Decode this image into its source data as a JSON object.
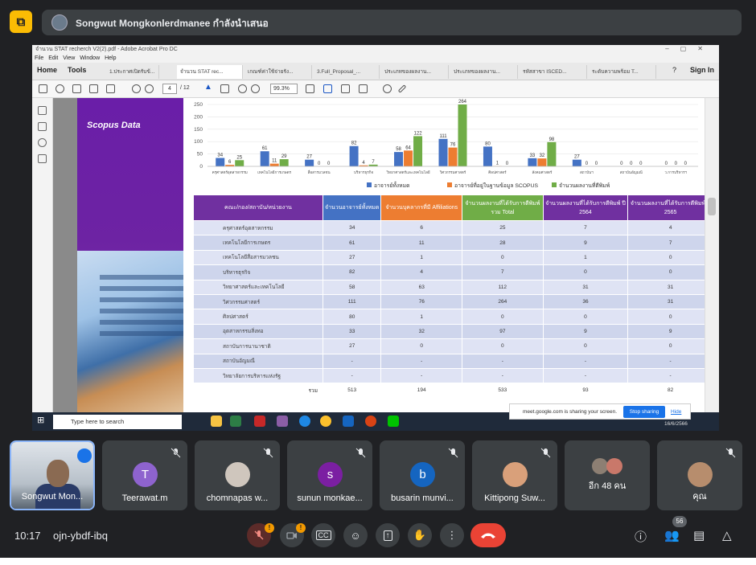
{
  "presenter": {
    "text": "Songwut Mongkonlerdmanee กำลังนำเสนอ"
  },
  "acrobat": {
    "window_title": "จำนวน STAT recherch V2(2).pdf - Adobe Acrobat Pro DC",
    "menu": "File Edit View Window Help",
    "home": "Home",
    "tools": "Tools",
    "sign_in": "Sign In",
    "tabs": [
      "1.ประกาศเปิดรับข้...",
      "จำนวน STAT rec...",
      "เกณฑ์ค่าใช้จ่ายรัง...",
      "3.Full_Proposal_...",
      "ประเภทของผลงาน...",
      "ประเภทของผลงาน...",
      "รหัสสาขา ISCED...",
      "ระดับความพร้อม T..."
    ],
    "page_current": "4",
    "page_total": "/ 12",
    "zoom": "99.3%",
    "sidebar_title": "Scopus Data"
  },
  "chart_data": {
    "type": "bar",
    "categories": [
      "ครุศาสตร์อุตสาหกรรม",
      "เทคโนโลยีการเกษตร",
      "สื่อสารมวลชน",
      "บริหารธุรกิจ",
      "วิทยาศาสตร์และเทคโนโลยี",
      "วิศวกรรมศาสตร์",
      "ศิลปศาสตร์",
      "สังคมศาสตร์",
      "สถาบันฯ",
      "สถาบันอัญมณี",
      "ว.การบริหารฯ"
    ],
    "series": [
      {
        "name": "อาจารย์ทั้งหมด",
        "color": "#4472c4",
        "values": [
          34,
          61,
          27,
          82,
          58,
          111,
          80,
          33,
          27,
          0,
          0
        ]
      },
      {
        "name": "อาจารย์ที่อยู่ในฐานข้อมูล SCOPUS",
        "color": "#ed7d31",
        "values": [
          6,
          11,
          0,
          4,
          64,
          76,
          1,
          32,
          0,
          0,
          0
        ]
      },
      {
        "name": "จำนวนผลงานที่ตีพิมพ์",
        "color": "#70ad47",
        "values": [
          25,
          29,
          0,
          7,
          122,
          264,
          0,
          98,
          0,
          0,
          0
        ]
      }
    ],
    "ylim": [
      0,
      250
    ],
    "yticks": [
      0,
      50,
      100,
      150,
      200,
      250
    ]
  },
  "table": {
    "headers": [
      "คณะ/กอง/สถาบัน/หน่วยงาน",
      "จำนวนอาจารย์ทั้งหมด",
      "จำนวนบุคลากรที่มี Affiliations",
      "จำนวนผลงานที่ได้รับการตีพิมพ์รวม Total",
      "จำนวนผลงานที่ได้รับการตีพิมพ์ ปี 2564",
      "จำนวนผลงานที่ได้รับการตีพิมพ์ ปี 2565"
    ],
    "header_colors": [
      "#7030a0",
      "#4472c4",
      "#ed7d31",
      "#70ad47",
      "#7030a0",
      "#7030a0"
    ],
    "rows": [
      [
        "ครุศาสตร์อุตสาหกรรม",
        "34",
        "6",
        "25",
        "7",
        "4"
      ],
      [
        "เทคโนโลยีการเกษตร",
        "61",
        "11",
        "28",
        "9",
        "7"
      ],
      [
        "เทคโนโลยีสื่อสารมวลชน",
        "27",
        "1",
        "0",
        "1",
        "0"
      ],
      [
        "บริหารธุรกิจ",
        "82",
        "4",
        "7",
        "0",
        "0"
      ],
      [
        "วิทยาศาสตร์และเทคโนโลยี",
        "58",
        "63",
        "112",
        "31",
        "31"
      ],
      [
        "วิศวกรรมศาสตร์",
        "111",
        "76",
        "264",
        "36",
        "31"
      ],
      [
        "ศิลปศาสตร์",
        "80",
        "1",
        "0",
        "0",
        "0"
      ],
      [
        "อุตสาหกรรมสิ่งทอ",
        "33",
        "32",
        "97",
        "9",
        "9"
      ],
      [
        "สถาบันการนานาชาติ",
        "27",
        "0",
        "0",
        "0",
        "0"
      ],
      [
        "สถาบันอัญมณี",
        "-",
        "-",
        "-",
        "-",
        "-"
      ],
      [
        "วิทยาลัยการบริหารแห่งรัฐ",
        "-",
        "-",
        "-",
        "-",
        "-"
      ]
    ],
    "total": [
      "รวม",
      "513",
      "194",
      "533",
      "93",
      "82"
    ]
  },
  "taskbar": {
    "search_placeholder": "Type here to search",
    "date": "16/6/2566"
  },
  "share_notice": {
    "text": "meet.google.com is sharing your screen.",
    "stop": "Stop sharing",
    "hide": "Hide"
  },
  "participants": [
    {
      "name": "Songwut Mon...",
      "type": "video"
    },
    {
      "name": "Teerawat.m",
      "initial": "T",
      "color": "#8e63ce"
    },
    {
      "name": "chomnapas w...",
      "type": "photo"
    },
    {
      "name": "sunun monkae...",
      "initial": "s",
      "color": "#7b1fa2"
    },
    {
      "name": "busarin munvi...",
      "initial": "b",
      "color": "#1565c0"
    },
    {
      "name": "Kittipong Suw...",
      "type": "photo"
    },
    {
      "name": "อีก 48 คน",
      "type": "group"
    },
    {
      "name": "คุณ",
      "type": "photo"
    }
  ],
  "bottom": {
    "time": "10:17",
    "code": "ojn-ybdf-ibq",
    "people_count": "56",
    "warn": "!"
  }
}
